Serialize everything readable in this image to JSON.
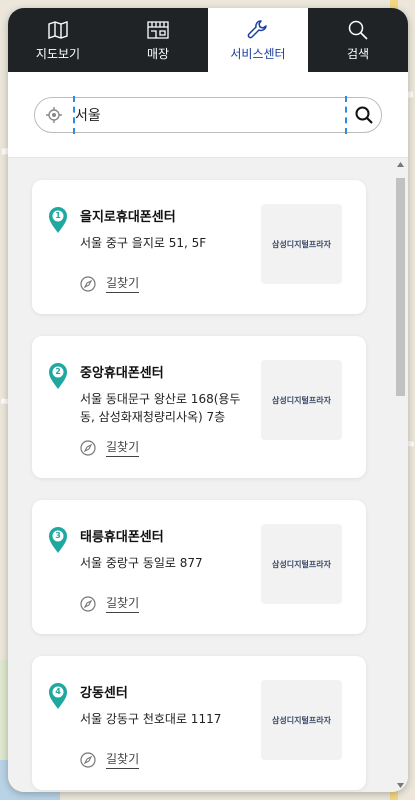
{
  "tabs": [
    {
      "label": "지도보기",
      "icon": "map-icon",
      "active": false
    },
    {
      "label": "매장",
      "icon": "store-icon",
      "active": false
    },
    {
      "label": "서비스센터",
      "icon": "wrench-icon",
      "active": true
    },
    {
      "label": "검색",
      "icon": "search-icon",
      "active": false
    }
  ],
  "search": {
    "value": "서울",
    "placeholder": ""
  },
  "thumb_text": "삼성디지털프라자",
  "route_label": "길찾기",
  "results": [
    {
      "num": "1",
      "name": "을지로휴대폰센터",
      "addr": "서울 중구 을지로 51, 5F"
    },
    {
      "num": "2",
      "name": "중앙휴대폰센터",
      "addr": "서울 동대문구 왕산로 168(용두동, 삼성화재청량리사옥) 7층"
    },
    {
      "num": "3",
      "name": "태릉휴대폰센터",
      "addr": "서울 중랑구 동일로 877"
    },
    {
      "num": "4",
      "name": "강동센터",
      "addr": "서울 강동구 천호대로 1117"
    }
  ],
  "colors": {
    "tab_bg": "#202325",
    "active_tab_text": "#1b3f9c",
    "pin": "#1fa8a0",
    "dash": "#2b8ce0"
  }
}
